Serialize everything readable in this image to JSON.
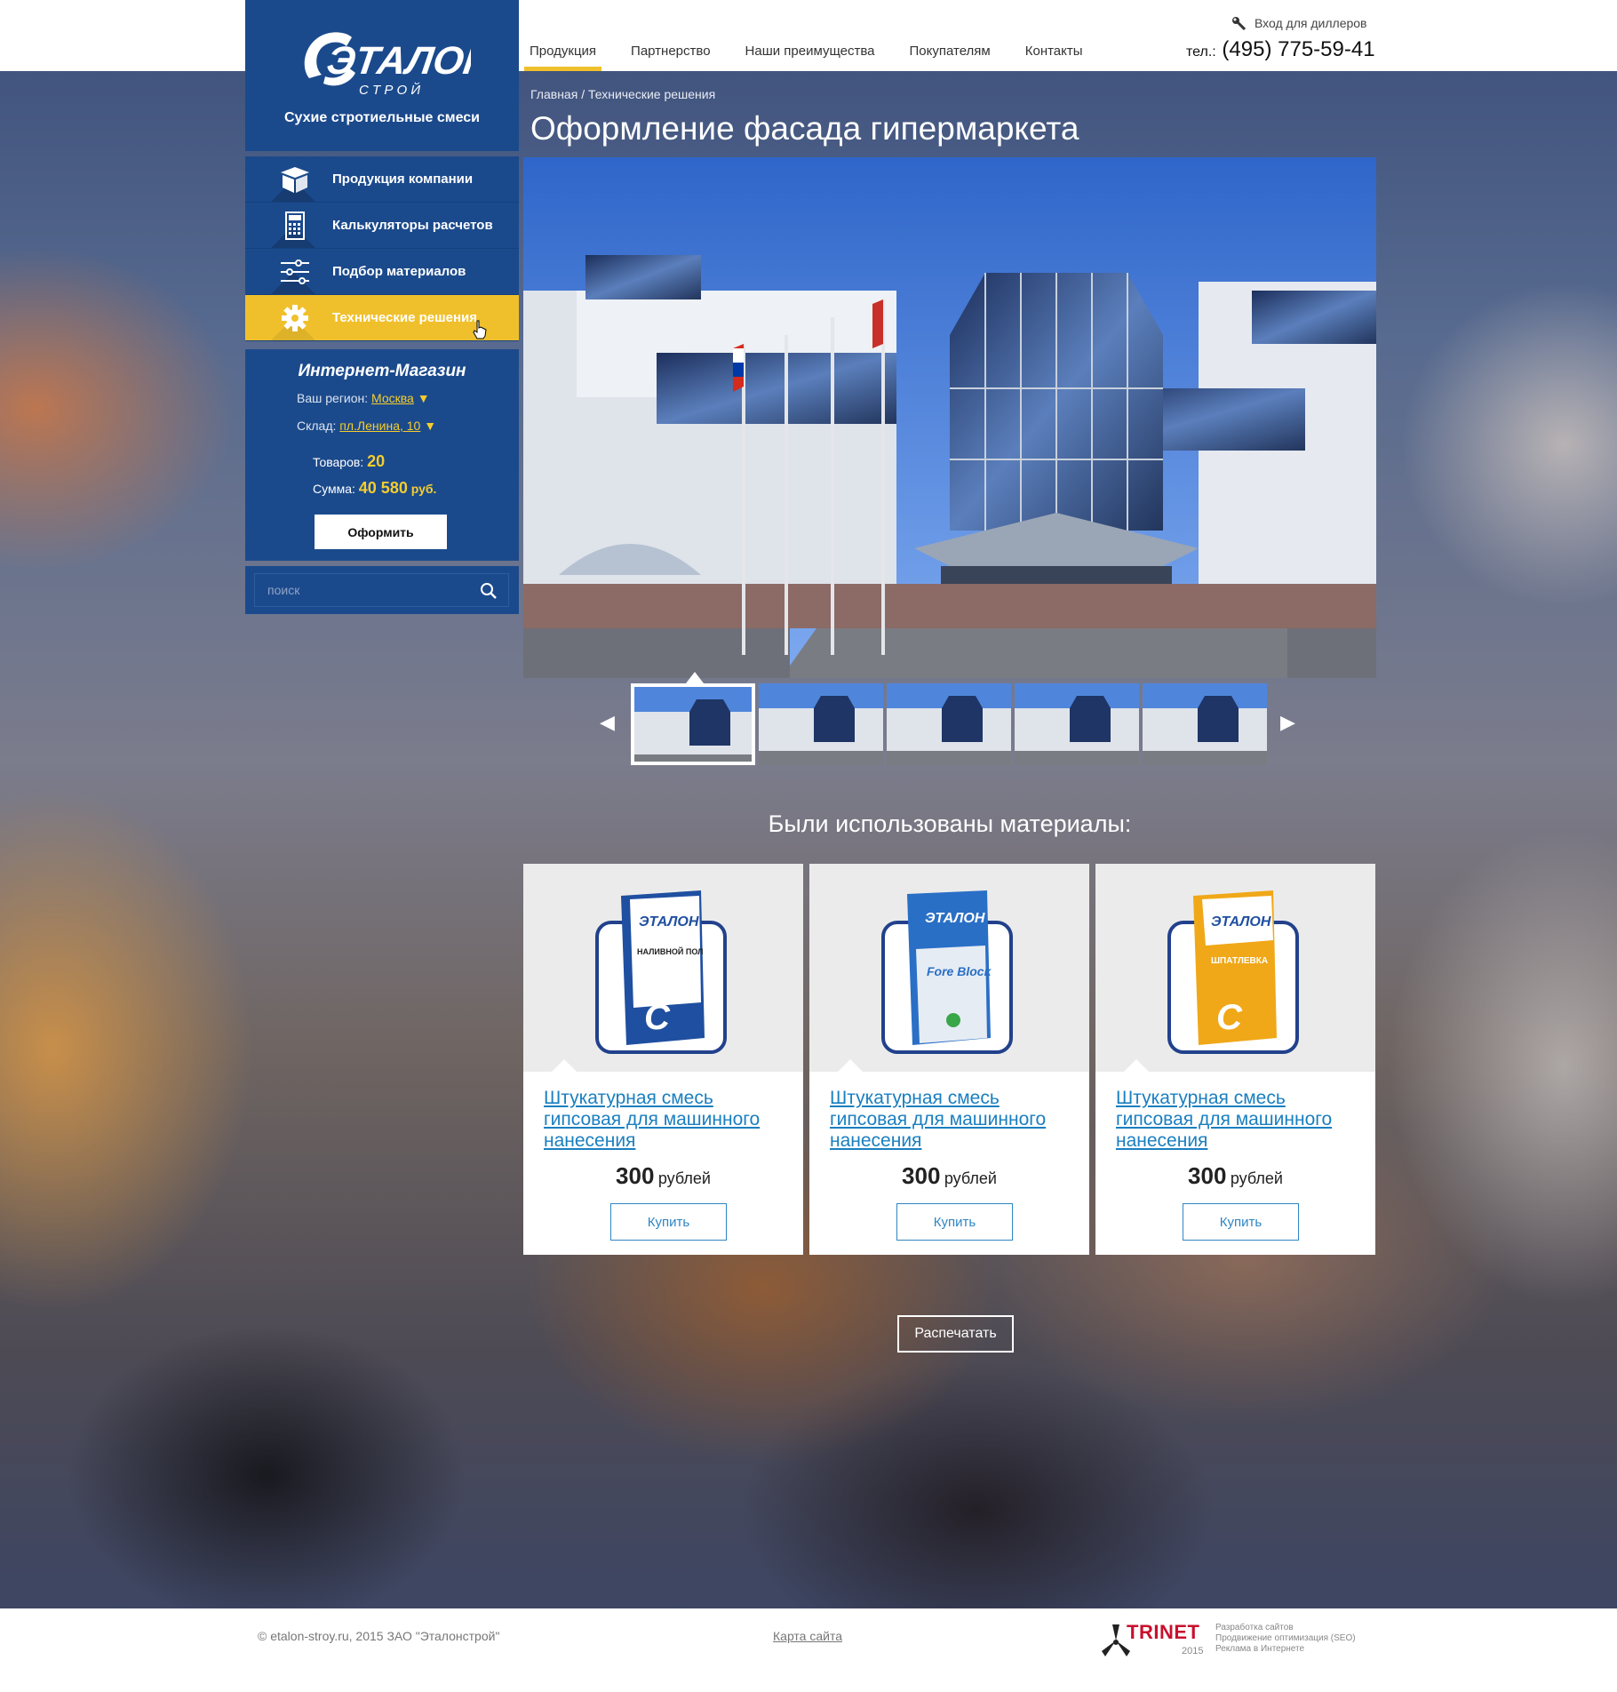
{
  "brand": {
    "logo_text": "ЭТАЛОН",
    "logo_sub": "С Т Р О Й",
    "tagline": "Сухие стротиельные смеси"
  },
  "nav": {
    "items": [
      {
        "label": "Продукция"
      },
      {
        "label": "Партнерство"
      },
      {
        "label": "Наши преимущества"
      },
      {
        "label": "Покупателям"
      },
      {
        "label": "Контакты"
      }
    ],
    "active": "Продукция",
    "dealer_login": "Вход для диллеров",
    "phone_prefix": "тел.:",
    "phone": "(495) 775-59-41"
  },
  "sidebar": {
    "menu": [
      {
        "label": "Продукция компании",
        "icon": "box-icon"
      },
      {
        "label": "Калькуляторы расчетов",
        "icon": "calculator-icon"
      },
      {
        "label": "Подбор материалов",
        "icon": "sliders-icon"
      },
      {
        "label": "Технические решения",
        "icon": "gear-icon"
      }
    ],
    "active_item": "Технические решения",
    "shop": {
      "title": "Интернет-Магазин",
      "region_label": "Ваш регион:",
      "region_value": "Москва",
      "warehouse_label": "Склад:",
      "warehouse_value": "пл.Ленина, 10",
      "items_label": "Товаров:",
      "items_count": "20",
      "sum_label": "Сумма:",
      "sum_value": "40 580",
      "sum_unit": "руб.",
      "order_button": "Оформить"
    },
    "search": {
      "placeholder": "поиск"
    }
  },
  "main": {
    "breadcrumb": [
      "Главная",
      "Технические решения"
    ],
    "breadcrumb_sep": "/",
    "title": "Оформление фасада гипермаркета",
    "gallery": {
      "thumb_count": 5,
      "active_index": 0,
      "prev": "◀",
      "next": "▶"
    },
    "materials_title": "Были использованы материалы:",
    "products": [
      {
        "name": "Штукатурная смесь гипсовая для машинного нанесения",
        "price": "300",
        "currency": "рублей",
        "buy": "Купить",
        "bag_color": "#1f4fa0",
        "bag_label": "НАЛИВНОЙ ПОЛ"
      },
      {
        "name": "Штукатурная смесь гипсовая для машинного нанесения",
        "price": "300",
        "currency": "рублей",
        "buy": "Купить",
        "bag_color": "#2a6fc6",
        "bag_label": "Fore Block"
      },
      {
        "name": "Штукатурная смесь гипсовая для машинного нанесения",
        "price": "300",
        "currency": "рублей",
        "buy": "Купить",
        "bag_color": "#f0a818",
        "bag_label": "ШПАТЛЕВКА"
      }
    ],
    "print_button": "Распечатать"
  },
  "footer": {
    "copyright": "© etalon-stroy.ru, 2015 ЗАО \"Эталонстрой\"",
    "sitemap": "Карта сайта",
    "dev_name": "TRINET",
    "dev_year": "2015",
    "dev_lines": [
      "Разработка сайтов",
      "Продвижение оптимизация (SEO)",
      "Реклама в Интернете"
    ]
  },
  "colors": {
    "brand_blue": "#1b4a8c",
    "accent_yellow": "#f0c02c",
    "link_blue": "#1a7fc0"
  }
}
